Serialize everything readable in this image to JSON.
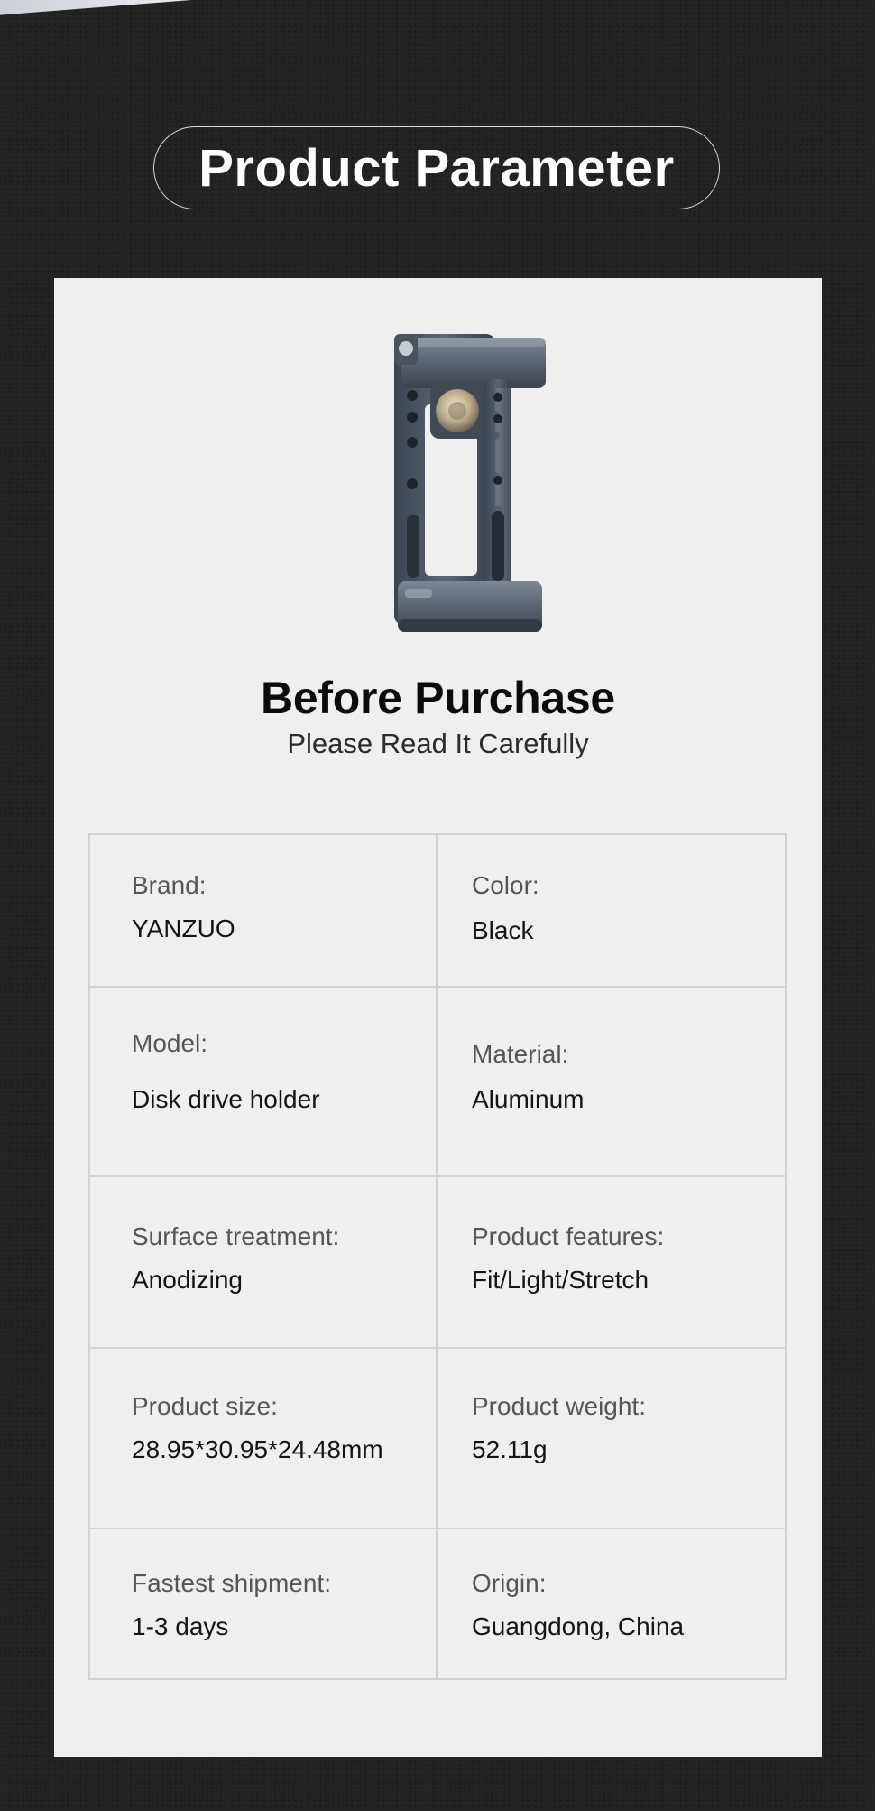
{
  "header": {
    "title": "Product Parameter"
  },
  "product": {
    "image_icon": "phone-clamp-holder-image"
  },
  "intro": {
    "heading": "Before Purchase",
    "subheading": "Please Read It Carefully"
  },
  "parameters": [
    {
      "left": {
        "label": "Brand:",
        "value": "YANZUO"
      },
      "right": {
        "label": "Color:",
        "value": "Black"
      }
    },
    {
      "left": {
        "label": "Model:",
        "value": "Disk drive holder"
      },
      "right": {
        "label": "Material:",
        "value": "Aluminum"
      }
    },
    {
      "left": {
        "label": "Surface treatment:",
        "value": "Anodizing"
      },
      "right": {
        "label": "Product features:",
        "value": "Fit/Light/Stretch"
      }
    },
    {
      "left": {
        "label": "Product size:",
        "value": "28.95*30.95*24.48mm"
      },
      "right": {
        "label": "Product weight:",
        "value": "52.11g"
      }
    },
    {
      "left": {
        "label": "Fastest shipment:",
        "value": "1-3 days"
      },
      "right": {
        "label": "Origin:",
        "value": "Guangdong, China"
      }
    }
  ],
  "colors": {
    "background": "#222222",
    "card": "#efefef",
    "border": "#d3d3d3",
    "title_text": "#ffffff"
  }
}
